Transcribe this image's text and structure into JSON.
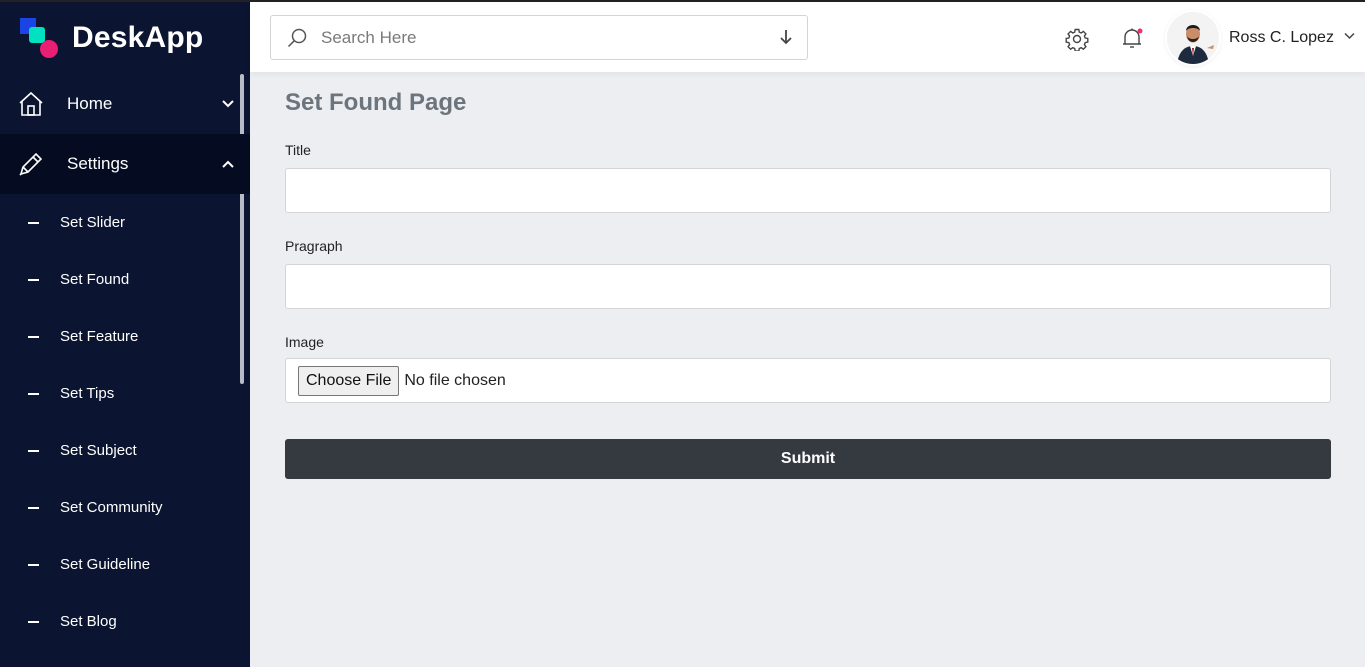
{
  "brand": {
    "name": "DeskApp"
  },
  "sidebar": {
    "items": [
      {
        "label": "Home",
        "icon": "home-icon",
        "expanded": false
      },
      {
        "label": "Settings",
        "icon": "pencil-icon",
        "expanded": true
      }
    ],
    "sub_items": [
      "Set Slider",
      "Set Found",
      "Set Feature",
      "Set Tips",
      "Set Subject",
      "Set Community",
      "Set Guideline",
      "Set Blog"
    ]
  },
  "header": {
    "search_placeholder": "Search Here",
    "user_name": "Ross C. Lopez",
    "notification_dot_color": "#e8336f"
  },
  "main": {
    "title": "Set Found Page",
    "fields": {
      "title_label": "Title",
      "title_value": "",
      "paragraph_label": "Pragraph",
      "paragraph_value": "",
      "image_label": "Image",
      "file_button": "Choose File",
      "file_status": "No file chosen"
    },
    "submit_label": "Submit"
  },
  "colors": {
    "sidebar_bg": "#0b1430",
    "page_bg": "#eceef2",
    "submit_bg": "#343a40",
    "title_color": "#6c757d"
  }
}
